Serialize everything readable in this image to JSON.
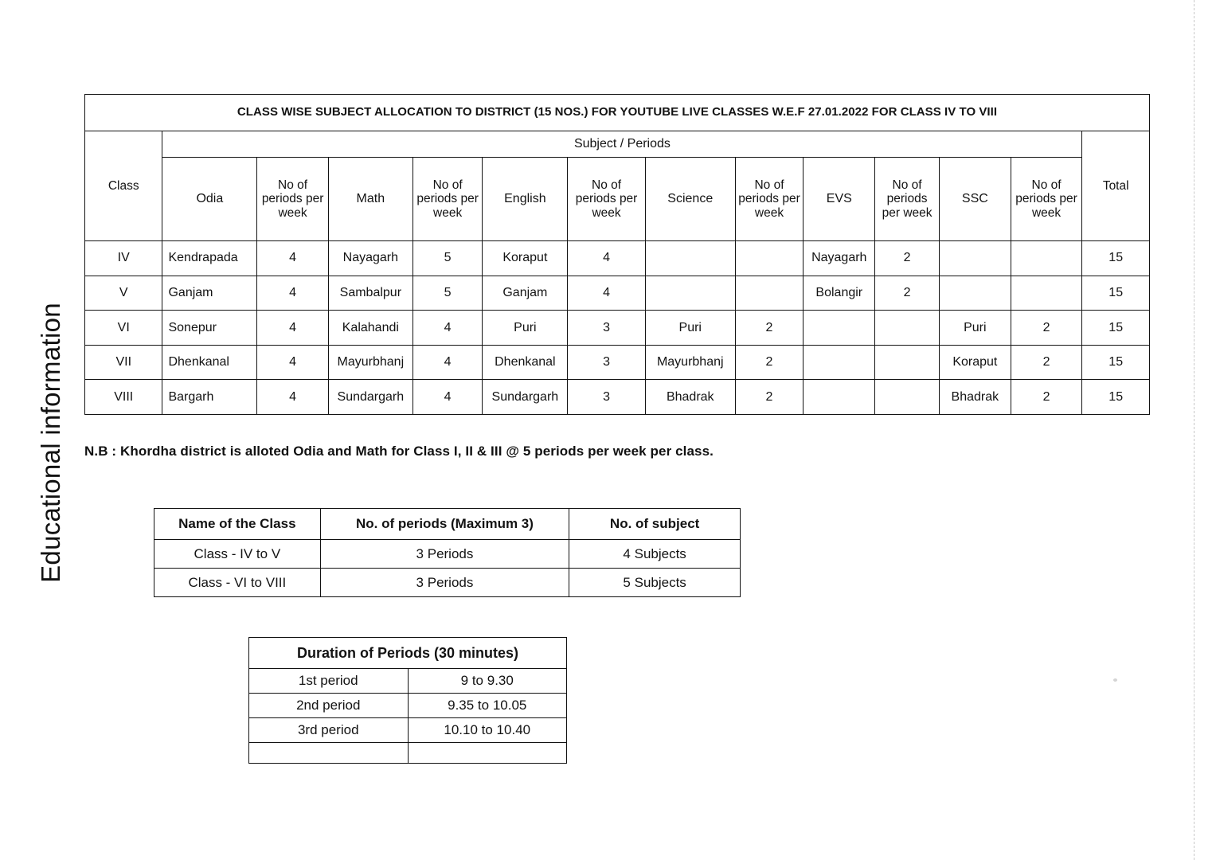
{
  "side_caption": "Educational information",
  "main_table": {
    "title": "CLASS WISE SUBJECT ALLOCATION TO DISTRICT (15 NOS.) FOR YOUTUBE LIVE CLASSES W.E.F 27.01.2022 FOR CLASS IV TO VIII",
    "group_header": "Subject / Periods",
    "headers": {
      "class": "Class",
      "odia": "Odia",
      "odia_periods": "No of periods per week",
      "math": "Math",
      "math_periods": "No of periods per week",
      "english": "English",
      "english_periods": "No of periods per week",
      "science": "Science",
      "science_periods": "No of periods per week",
      "evs": "EVS",
      "evs_periods": "No of periods per week",
      "ssc": "SSC",
      "ssc_periods": "No of periods per week",
      "total": "Total"
    },
    "rows": [
      {
        "class": "IV",
        "odia": "Kendrapada",
        "odia_periods": "4",
        "math": "Nayagarh",
        "math_periods": "5",
        "english": "Koraput",
        "english_periods": "4",
        "science": "",
        "science_periods": "",
        "evs": "Nayagarh",
        "evs_periods": "2",
        "ssc": "",
        "ssc_periods": "",
        "total": "15"
      },
      {
        "class": "V",
        "odia": "Ganjam",
        "odia_periods": "4",
        "math": "Sambalpur",
        "math_periods": "5",
        "english": "Ganjam",
        "english_periods": "4",
        "science": "",
        "science_periods": "",
        "evs": "Bolangir",
        "evs_periods": "2",
        "ssc": "",
        "ssc_periods": "",
        "total": "15"
      },
      {
        "class": "VI",
        "odia": "Sonepur",
        "odia_periods": "4",
        "math": "Kalahandi",
        "math_periods": "4",
        "english": "Puri",
        "english_periods": "3",
        "science": "Puri",
        "science_periods": "2",
        "evs": "",
        "evs_periods": "",
        "ssc": "Puri",
        "ssc_periods": "2",
        "total": "15"
      },
      {
        "class": "VII",
        "odia": "Dhenkanal",
        "odia_periods": "4",
        "math": "Mayurbhanj",
        "math_periods": "4",
        "english": "Dhenkanal",
        "english_periods": "3",
        "science": "Mayurbhanj",
        "science_periods": "2",
        "evs": "",
        "evs_periods": "",
        "ssc": "Koraput",
        "ssc_periods": "2",
        "total": "15"
      },
      {
        "class": "VIII",
        "odia": "Bargarh",
        "odia_periods": "4",
        "math": "Sundargarh",
        "math_periods": "4",
        "english": "Sundargarh",
        "english_periods": "3",
        "science": "Bhadrak",
        "science_periods": "2",
        "evs": "",
        "evs_periods": "",
        "ssc": "Bhadrak",
        "ssc_periods": "2",
        "total": "15"
      }
    ]
  },
  "note": "N.B : Khordha district is alloted Odia and Math for Class I, II & III @ 5 periods per week per class.",
  "periods_table": {
    "headers": [
      "Name of the Class",
      "No. of periods (Maximum 3)",
      "No. of subject"
    ],
    "rows": [
      {
        "name": "Class - IV to V",
        "periods": "3 Periods",
        "subjects": "4 Subjects"
      },
      {
        "name": "Class - VI to VIII",
        "periods": "3 Periods",
        "subjects": "5 Subjects"
      }
    ]
  },
  "duration_table": {
    "title": "Duration of Periods (30 minutes)",
    "rows": [
      {
        "period": "1st period",
        "time": "9 to 9.30"
      },
      {
        "period": "2nd period",
        "time": "9.35 to 10.05"
      },
      {
        "period": "3rd period",
        "time": "10.10 to 10.40"
      },
      {
        "period": "",
        "time": ""
      }
    ]
  }
}
